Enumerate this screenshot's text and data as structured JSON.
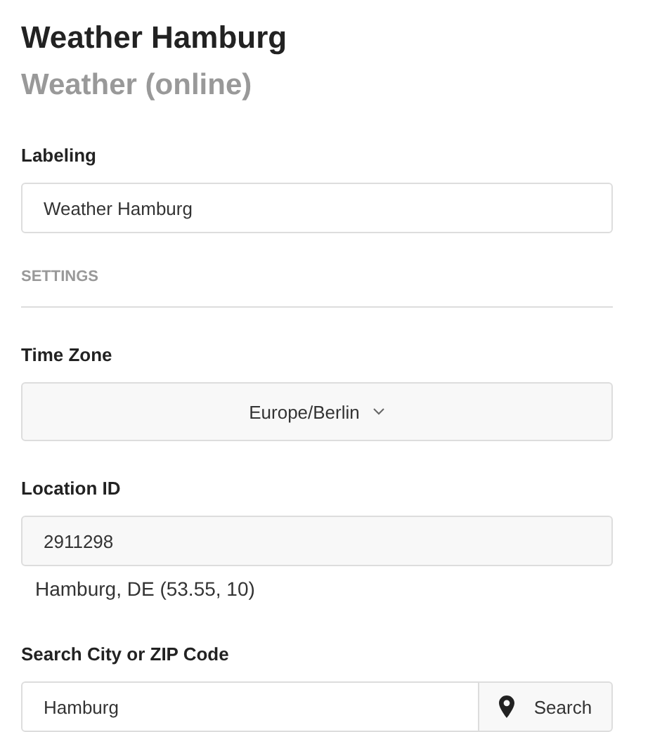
{
  "title": "Weather Hamburg",
  "subtitle": "Weather (online)",
  "labeling": {
    "label": "Labeling",
    "value": "Weather Hamburg"
  },
  "section": "SETTINGS",
  "time_zone": {
    "label": "Time Zone",
    "value": "Europe/Berlin"
  },
  "location_id": {
    "label": "Location ID",
    "value": "2911298",
    "resolved": "Hamburg, DE (53.55, 10)"
  },
  "search": {
    "label": "Search City or ZIP Code",
    "value": "Hamburg",
    "button": "Search"
  }
}
